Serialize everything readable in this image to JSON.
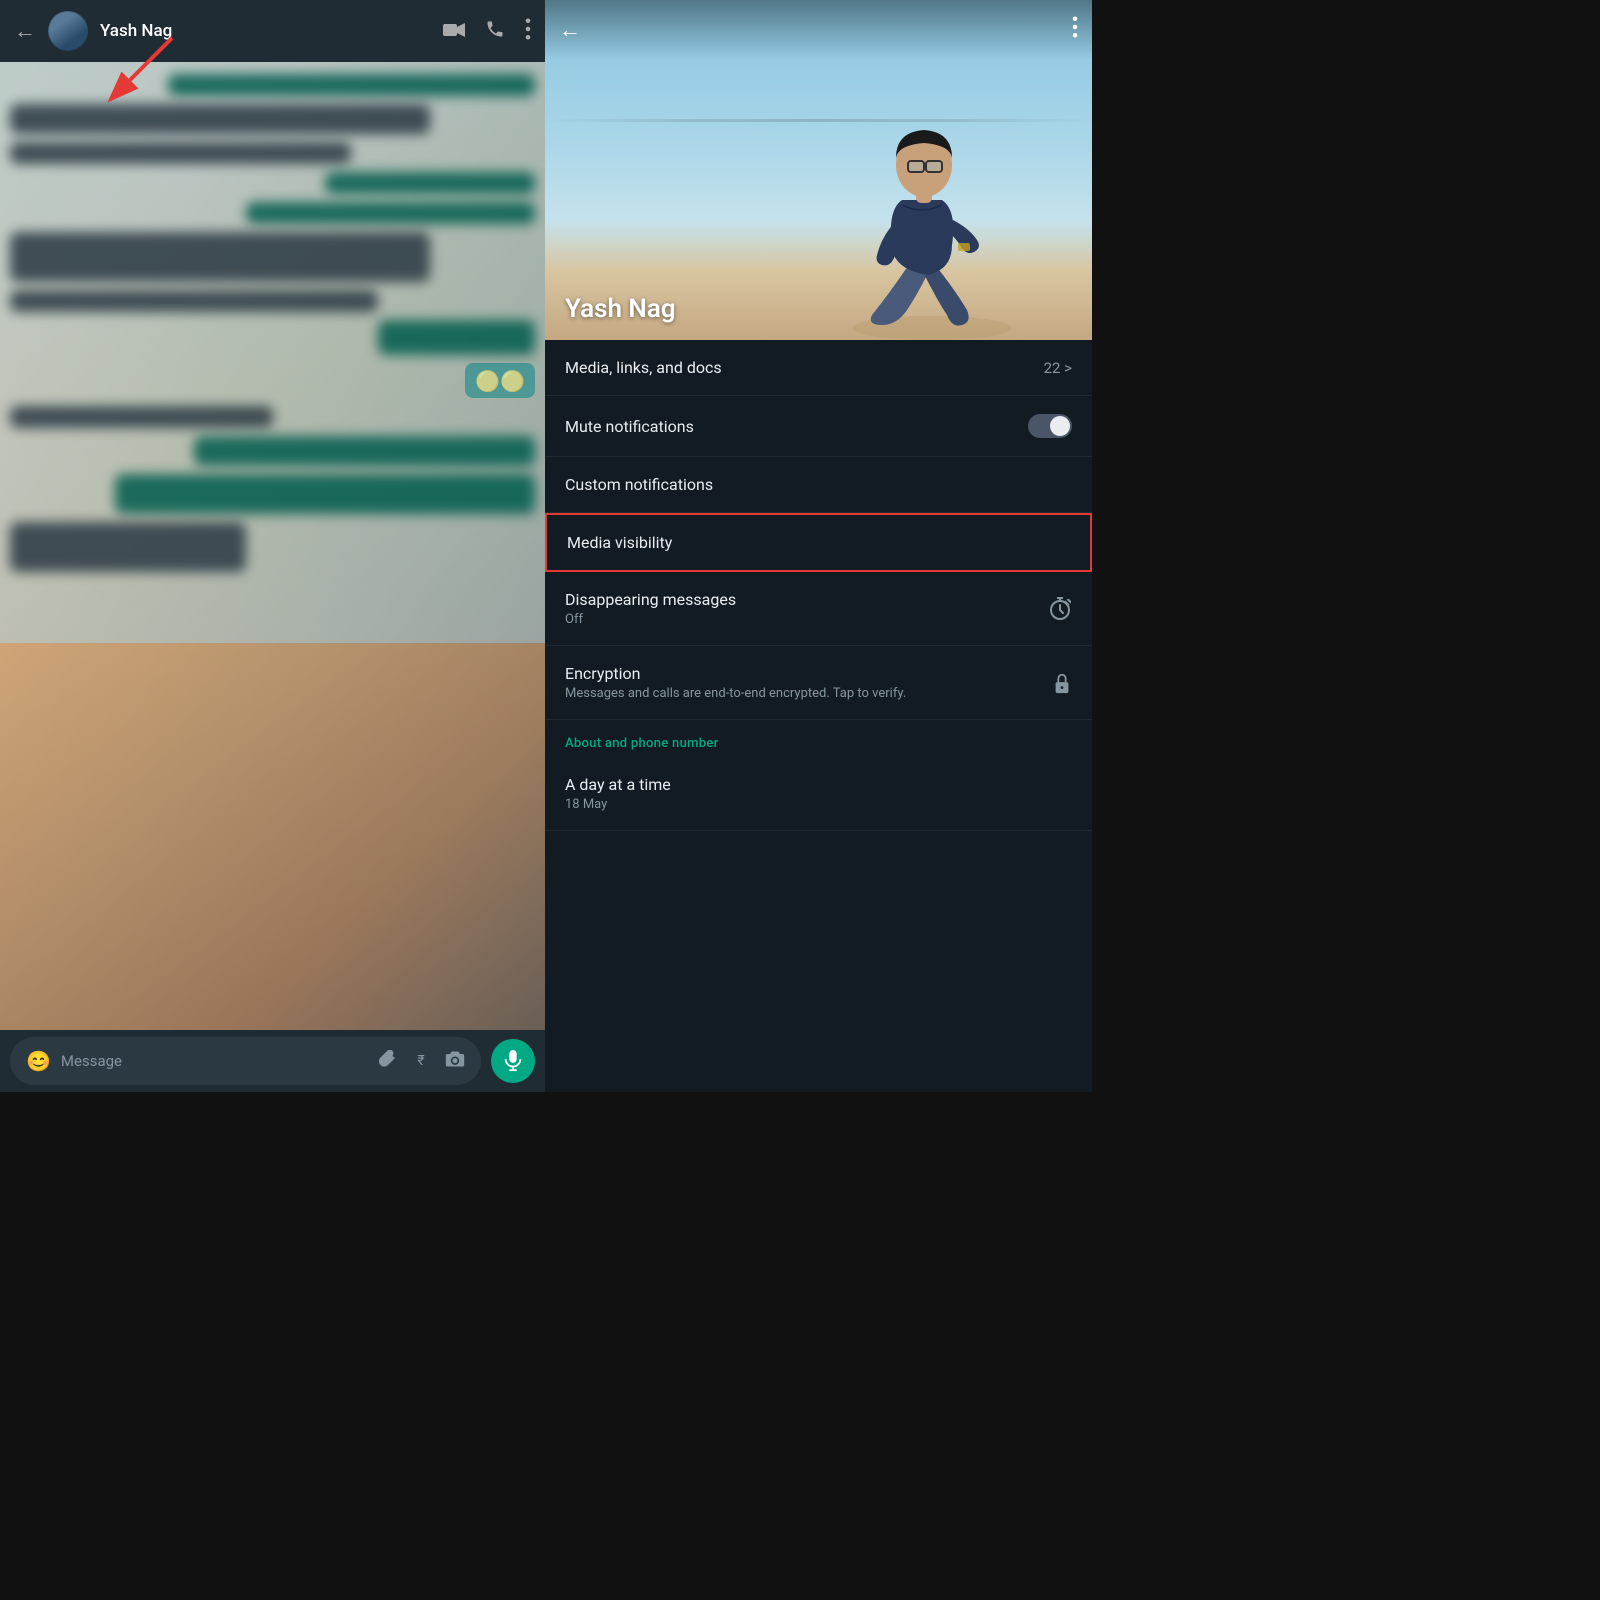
{
  "leftPanel": {
    "header": {
      "back": "←",
      "name": "Yash Nag",
      "icons": {
        "video": "📹",
        "call": "📞",
        "more": "⋮"
      }
    },
    "inputBar": {
      "emoji": "😊",
      "placeholder": "Message",
      "attach": "📎",
      "rupee": "₹",
      "camera": "📷",
      "mic": "🎤"
    }
  },
  "rightPanel": {
    "header": {
      "back": "←",
      "more": "⋮"
    },
    "profileName": "Yash Nag",
    "menuItems": [
      {
        "id": "media",
        "title": "Media, links, and docs",
        "subtitle": "",
        "rightValue": "22 >",
        "highlighted": false
      },
      {
        "id": "mute",
        "title": "Mute notifications",
        "subtitle": "",
        "rightValue": "toggle",
        "highlighted": false
      },
      {
        "id": "custom-notifications",
        "title": "Custom notifications",
        "subtitle": "",
        "rightValue": "",
        "highlighted": false
      },
      {
        "id": "media-visibility",
        "title": "Media visibility",
        "subtitle": "",
        "rightValue": "",
        "highlighted": true
      },
      {
        "id": "disappearing",
        "title": "Disappearing messages",
        "subtitle": "Off",
        "rightValue": "timer",
        "highlighted": false
      },
      {
        "id": "encryption",
        "title": "Encryption",
        "subtitle": "Messages and calls are end-to-end encrypted. Tap to verify.",
        "rightValue": "lock",
        "highlighted": false
      }
    ],
    "sectionLabel": "About and phone number",
    "aboutItems": [
      {
        "id": "about",
        "title": "A day at a time",
        "subtitle": "18 May"
      }
    ]
  }
}
